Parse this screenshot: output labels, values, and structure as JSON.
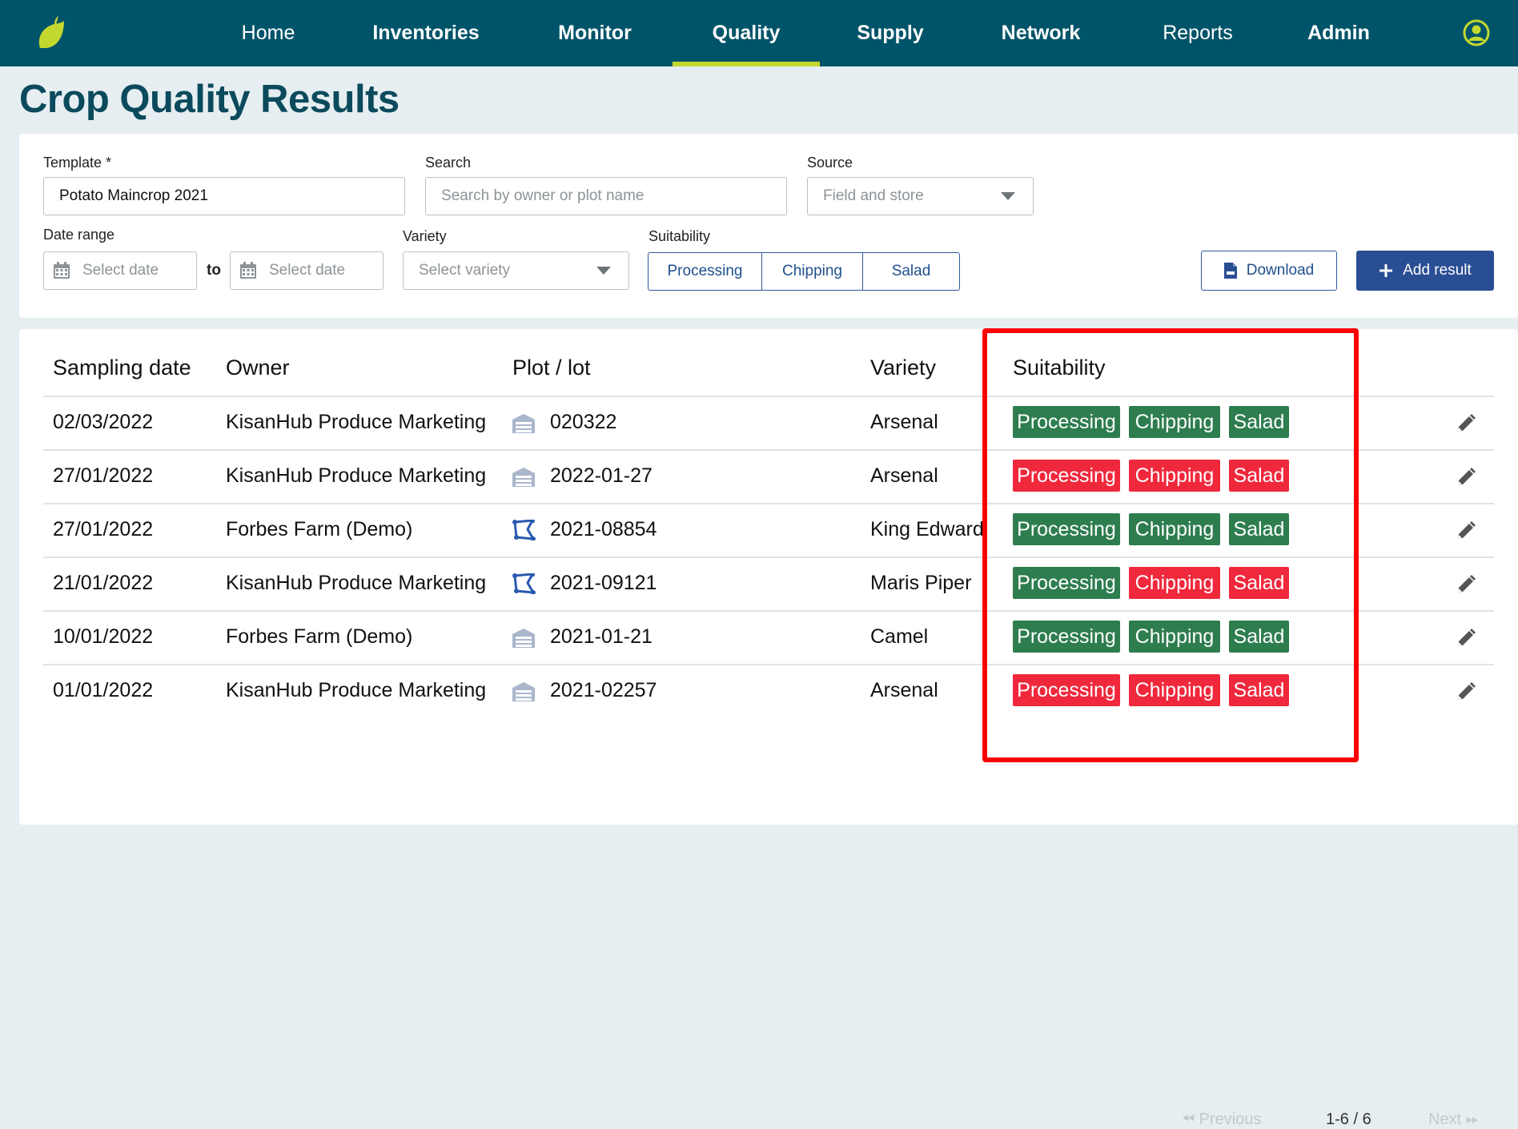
{
  "nav": {
    "items": [
      {
        "label": "Home",
        "bold": false,
        "active": false
      },
      {
        "label": "Inventories",
        "bold": true,
        "active": false
      },
      {
        "label": "Monitor",
        "bold": true,
        "active": false
      },
      {
        "label": "Quality",
        "bold": true,
        "active": true
      },
      {
        "label": "Supply",
        "bold": true,
        "active": false
      },
      {
        "label": "Network",
        "bold": true,
        "active": false
      },
      {
        "label": "Reports",
        "bold": false,
        "active": false
      },
      {
        "label": "Admin",
        "bold": true,
        "active": false
      }
    ],
    "logo_icon": "leaf-logo-icon",
    "user_icon": "user-circle-icon"
  },
  "page_title": "Crop Quality Results",
  "filters": {
    "template": {
      "label": "Template *",
      "value": "Potato Maincrop 2021"
    },
    "search": {
      "label": "Search",
      "placeholder": "Search by owner or plot name"
    },
    "source": {
      "label": "Source",
      "value": "Field and store"
    },
    "date_range": {
      "label": "Date range",
      "from_placeholder": "Select date",
      "to_label": "to",
      "to_placeholder": "Select date"
    },
    "variety": {
      "label": "Variety",
      "placeholder": "Select variety"
    },
    "suitability": {
      "label": "Suitability",
      "options": [
        "Processing",
        "Chipping",
        "Salad"
      ]
    },
    "download_label": "Download",
    "add_result_label": "Add result"
  },
  "table": {
    "headers": {
      "sampling_date": "Sampling date",
      "owner": "Owner",
      "plot_lot": "Plot / lot",
      "variety": "Variety",
      "suitability": "Suitability"
    },
    "rows": [
      {
        "date": "02/03/2022",
        "owner": "KisanHub Produce Marketing",
        "plot_type": "store",
        "plot": "020322",
        "variety": "Arsenal",
        "processing": "Processing",
        "chipping": "Chipping",
        "salad": "Salad",
        "processing_ok": true,
        "chipping_ok": true,
        "salad_ok": true
      },
      {
        "date": "27/01/2022",
        "owner": "KisanHub Produce Marketing",
        "plot_type": "store",
        "plot": "2022-01-27",
        "variety": "Arsenal",
        "processing": "Processing",
        "chipping": "Chipping",
        "salad": "Salad",
        "processing_ok": false,
        "chipping_ok": false,
        "salad_ok": false
      },
      {
        "date": "27/01/2022",
        "owner": "Forbes Farm (Demo)",
        "plot_type": "field",
        "plot": "2021-08854",
        "variety": "King Edward",
        "processing": "Processing",
        "chipping": "Chipping",
        "salad": "Salad",
        "processing_ok": true,
        "chipping_ok": true,
        "salad_ok": true
      },
      {
        "date": "21/01/2022",
        "owner": "KisanHub Produce Marketing",
        "plot_type": "field",
        "plot": "2021-09121",
        "variety": "Maris Piper",
        "processing": "Processing",
        "chipping": "Chipping",
        "salad": "Salad",
        "processing_ok": true,
        "chipping_ok": false,
        "salad_ok": false
      },
      {
        "date": "10/01/2022",
        "owner": "Forbes Farm (Demo)",
        "plot_type": "store",
        "plot": "2021-01-21",
        "variety": "Camel",
        "processing": "Processing",
        "chipping": "Chipping",
        "salad": "Salad",
        "processing_ok": true,
        "chipping_ok": true,
        "salad_ok": true
      },
      {
        "date": "01/01/2022",
        "owner": "KisanHub Produce Marketing",
        "plot_type": "store",
        "plot": "2021-02257",
        "variety": "Arsenal",
        "processing": "Processing",
        "chipping": "Chipping",
        "salad": "Salad",
        "processing_ok": false,
        "chipping_ok": false,
        "salad_ok": false
      }
    ]
  },
  "pagination": {
    "previous": "Previous",
    "range": "1-6 / 6",
    "next": "Next"
  },
  "colors": {
    "nav_bg": "#005469",
    "nav_active_underline": "#c3d82f",
    "title": "#0b4a5c",
    "badge_good": "#2e7d4f",
    "badge_bad": "#f0283c",
    "primary_button": "#2a4e94",
    "highlight_box": "#ff0000"
  }
}
